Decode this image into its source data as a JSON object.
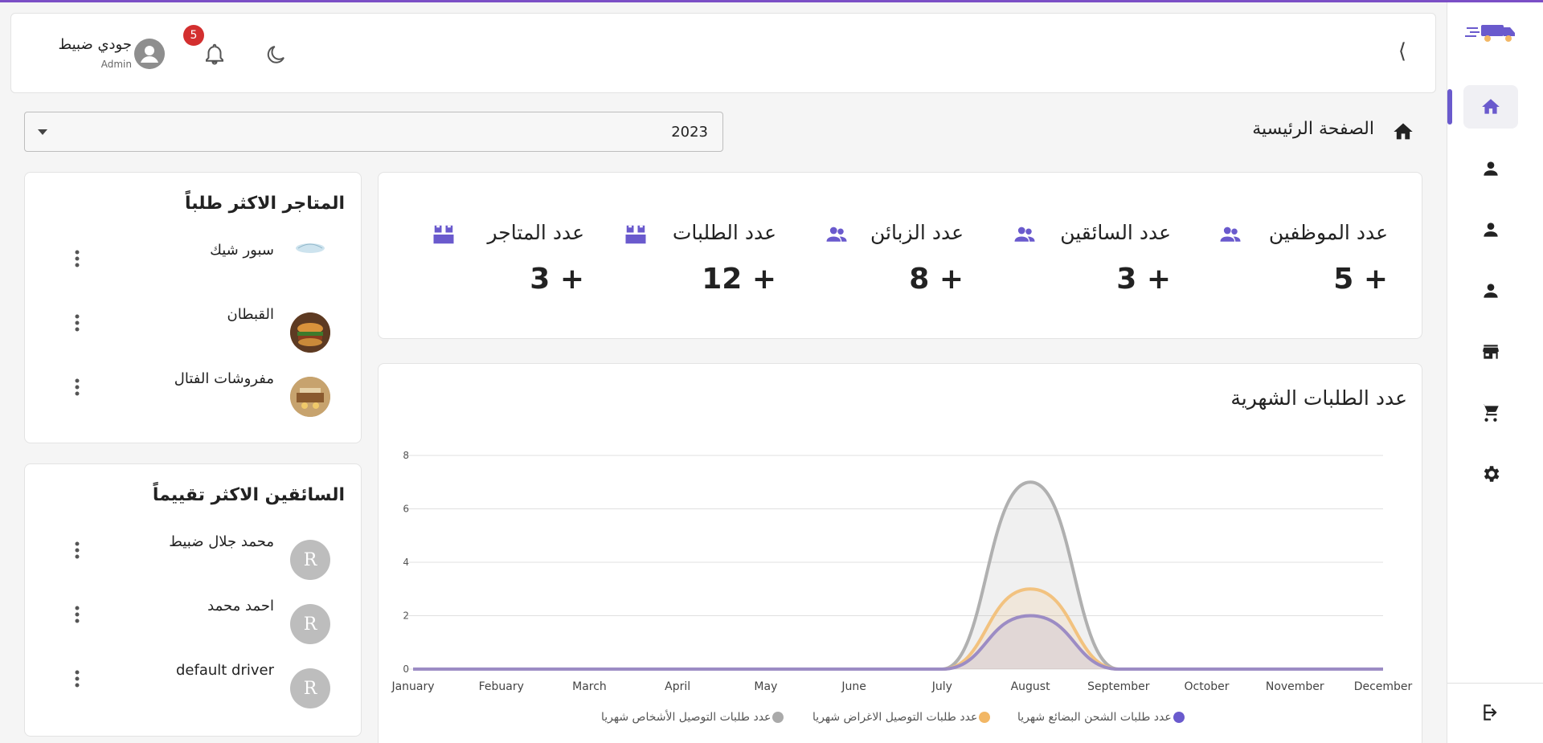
{
  "header": {
    "user_name": "جودي ضبيط",
    "user_role": "Admin",
    "notification_count": "5",
    "collapse_glyph": "⟨"
  },
  "sidebar": {
    "items": [
      {
        "icon": "home-icon",
        "active": true
      },
      {
        "icon": "person-icon"
      },
      {
        "icon": "person-icon"
      },
      {
        "icon": "person-icon"
      },
      {
        "icon": "store-icon"
      },
      {
        "icon": "cart-icon"
      },
      {
        "icon": "gear-icon"
      }
    ],
    "bottom_icon": "logout-icon"
  },
  "breadcrumb": {
    "title": "الصفحة الرئيسية"
  },
  "year_select": {
    "value": "2023"
  },
  "stats": [
    {
      "label": "عدد الموظفين",
      "value": "5 +",
      "icon": "group-icon"
    },
    {
      "label": "عدد السائقين",
      "value": "3 +",
      "icon": "group-icon"
    },
    {
      "label": "عدد الزبائن",
      "value": "8 +",
      "icon": "group-icon"
    },
    {
      "label": "عدد الطلبات",
      "value": "12 +",
      "icon": "boxes-icon"
    },
    {
      "label": "عدد المتاجر",
      "value": "3 +",
      "icon": "boxes-icon"
    }
  ],
  "top_stores": {
    "title": "المتاجر الاكثر طلباً",
    "items": [
      {
        "name": "سبور شيك"
      },
      {
        "name": "القبطان"
      },
      {
        "name": "مفروشات الفتال"
      }
    ]
  },
  "top_drivers": {
    "title": "السائقين الاكثر تقييماً",
    "items": [
      {
        "name": "محمد جلال ضبيط",
        "initial": "R"
      },
      {
        "name": "احمد محمد",
        "initial": "R"
      },
      {
        "name": "default driver",
        "initial": "R"
      }
    ]
  },
  "colors": {
    "accent": "#6a5acd",
    "series_goods": "#7a68c6",
    "series_items": "#f2b765",
    "series_persons": "#aaaaaa"
  },
  "chart_data": {
    "type": "area",
    "title": "عدد الطلبات الشهرية",
    "categories": [
      "January",
      "Febuary",
      "March",
      "April",
      "May",
      "June",
      "July",
      "August",
      "September",
      "October",
      "November",
      "December"
    ],
    "ylim": [
      0,
      8
    ],
    "yticks": [
      0,
      2,
      4,
      6,
      8
    ],
    "grid": true,
    "legend_position": "bottom",
    "series": [
      {
        "name": "عدد طلبات الشحن البضائع شهريا",
        "values": [
          0,
          0,
          0,
          0,
          0,
          0,
          0,
          2,
          0,
          0,
          0,
          0
        ]
      },
      {
        "name": "عدد طلبات التوصيل الاغراض شهريا",
        "values": [
          0,
          0,
          0,
          0,
          0,
          0,
          0,
          3,
          0,
          0,
          0,
          0
        ]
      },
      {
        "name": "عدد طلبات التوصيل الأشخاص شهريا",
        "values": [
          0,
          0,
          0,
          0,
          0,
          0,
          0,
          7,
          0,
          0,
          0,
          0
        ]
      }
    ]
  }
}
